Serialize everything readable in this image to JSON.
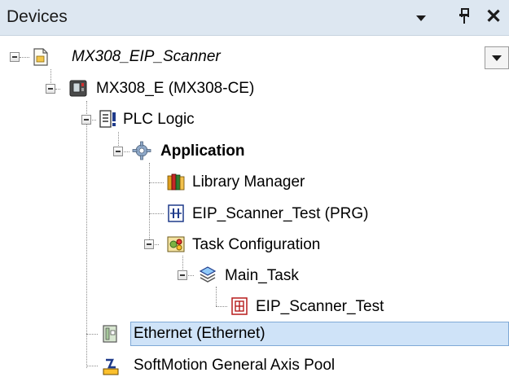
{
  "panel": {
    "title": "Devices",
    "close_glyph": "✕"
  },
  "tree": {
    "project": "MX308_EIP_Scanner",
    "device": "MX308_E (MX308-CE)",
    "plc_logic": "PLC Logic",
    "application": "Application",
    "library_manager": "Library Manager",
    "program": "EIP_Scanner_Test (PRG)",
    "task_configuration": "Task Configuration",
    "main_task": "Main_Task",
    "task_call": "EIP_Scanner_Test",
    "ethernet": "Ethernet (Ethernet)",
    "axis_pool": "SoftMotion General Axis Pool"
  },
  "icons": {
    "project": "project-document-icon",
    "device": "plc-device-icon",
    "plc_logic": "plc-logic-icon",
    "application": "application-gear-icon",
    "library_manager": "library-books-icon",
    "program": "program-prg-icon",
    "task_configuration": "task-configuration-icon",
    "main_task": "task-stack-icon",
    "task_call": "program-call-icon",
    "ethernet": "ethernet-module-icon",
    "axis_pool": "axis-pool-icon"
  },
  "colors": {
    "title_bar": "#dde7f1",
    "selection": "#cfe3f8",
    "selection_border": "#7fa9d6"
  }
}
